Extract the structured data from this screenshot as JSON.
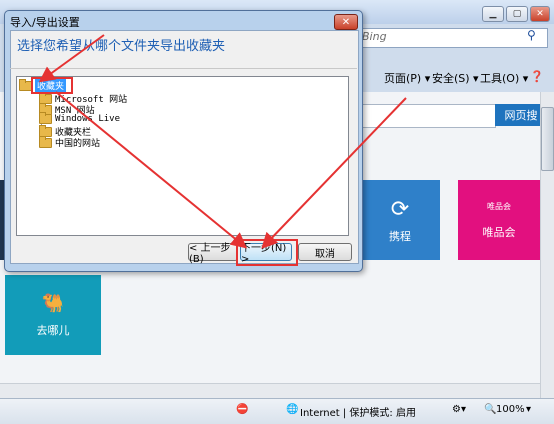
{
  "browser": {
    "search_placeholder": "Bing",
    "command_bar": [
      "页面(P) ▾",
      "安全(S) ▾",
      "工具(O) ▾"
    ],
    "web_search_button": "网页搜",
    "tiles": {
      "ctrip": "携程",
      "vip_small": "唯品会",
      "vip": "唯品会",
      "qunar": "去哪儿"
    },
    "status": {
      "zone": "Internet | 保护模式: 启用",
      "zoom": "100%"
    }
  },
  "dialog": {
    "title": "导入/导出设置",
    "prompt": "选择您希望从哪个文件夹导出收藏夹",
    "tree": {
      "root": "收藏夹",
      "children": [
        "Microsoft 网站",
        "MSN 网站",
        "Windows Live",
        "收藏夹栏",
        "中国的网站"
      ]
    },
    "buttons": {
      "back": "< 上一步(B)",
      "next": "下一步(N) >",
      "cancel": "取消"
    }
  },
  "colors": {
    "annotation": "#e53232",
    "selection": "#3399ff",
    "prompt": "#1e5fb4"
  }
}
